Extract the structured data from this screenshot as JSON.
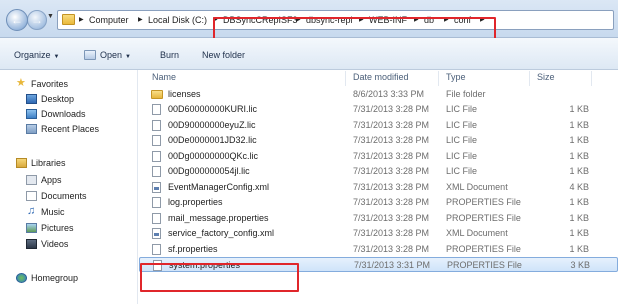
{
  "address_bar": {
    "path": [
      "Computer",
      "Local Disk (C:)",
      "DBSyncCRepISF3",
      "dbsync-repl",
      "WEB-INF",
      "db",
      "conf"
    ]
  },
  "toolbar": {
    "organize": "Organize",
    "open": "Open",
    "burn": "Burn",
    "new_folder": "New folder"
  },
  "sidebar": {
    "favorites": "Favorites",
    "favorites_items": [
      "Desktop",
      "Downloads",
      "Recent Places"
    ],
    "libraries": "Libraries",
    "libraries_items": [
      "Apps",
      "Documents",
      "Music",
      "Pictures",
      "Videos"
    ],
    "homegroup": "Homegroup"
  },
  "columns": {
    "name": "Name",
    "date": "Date modified",
    "type": "Type",
    "size": "Size"
  },
  "files": [
    {
      "name": "licenses",
      "date": "8/6/2013 3:33 PM",
      "type": "File folder",
      "size": "",
      "icon": "folder-icon"
    },
    {
      "name": "00D60000000KURI.lic",
      "date": "7/31/2013 3:28 PM",
      "type": "LIC File",
      "size": "1 KB",
      "icon": "document-icon"
    },
    {
      "name": "00D90000000eyuZ.lic",
      "date": "7/31/2013 3:28 PM",
      "type": "LIC File",
      "size": "1 KB",
      "icon": "document-icon"
    },
    {
      "name": "00De0000001JD32.lic",
      "date": "7/31/2013 3:28 PM",
      "type": "LIC File",
      "size": "1 KB",
      "icon": "document-icon"
    },
    {
      "name": "00Dg00000000QKc.lic",
      "date": "7/31/2013 3:28 PM",
      "type": "LIC File",
      "size": "1 KB",
      "icon": "document-icon"
    },
    {
      "name": "00Dg000000054jl.lic",
      "date": "7/31/2013 3:28 PM",
      "type": "LIC File",
      "size": "1 KB",
      "icon": "document-icon"
    },
    {
      "name": "EventManagerConfig.xml",
      "date": "7/31/2013 3:28 PM",
      "type": "XML Document",
      "size": "4 KB",
      "icon": "xml-file-icon"
    },
    {
      "name": "log.properties",
      "date": "7/31/2013 3:28 PM",
      "type": "PROPERTIES File",
      "size": "1 KB",
      "icon": "document-icon"
    },
    {
      "name": "mail_message.properties",
      "date": "7/31/2013 3:28 PM",
      "type": "PROPERTIES File",
      "size": "1 KB",
      "icon": "document-icon"
    },
    {
      "name": "service_factory_config.xml",
      "date": "7/31/2013 3:28 PM",
      "type": "XML Document",
      "size": "1 KB",
      "icon": "xml-file-icon"
    },
    {
      "name": "sf.properties",
      "date": "7/31/2013 3:28 PM",
      "type": "PROPERTIES File",
      "size": "1 KB",
      "icon": "document-icon"
    },
    {
      "name": "system.properties",
      "date": "7/31/2013 3:31 PM",
      "type": "PROPERTIES File",
      "size": "3 KB",
      "icon": "document-icon",
      "selected": true
    }
  ],
  "colors": {
    "highlight": "#e0262b",
    "selection": "#cfe4fa"
  }
}
